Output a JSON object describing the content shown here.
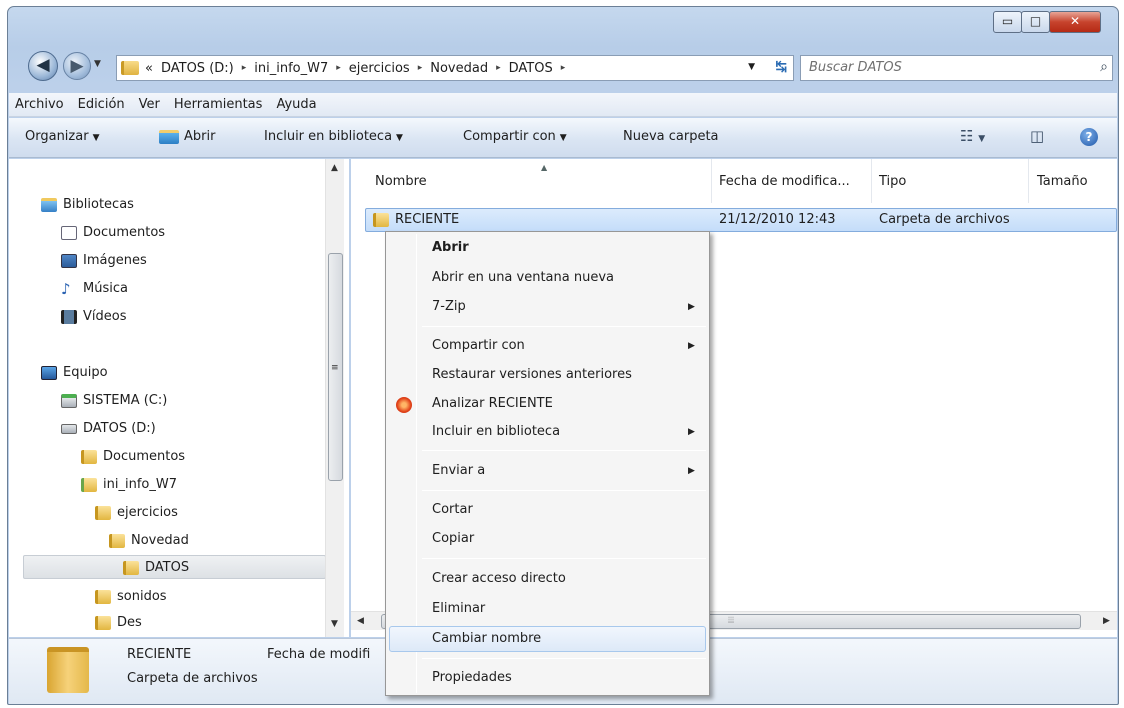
{
  "window": {
    "controls": {
      "minimize": "▭",
      "maximize": "□",
      "close": "✕"
    }
  },
  "nav": {
    "back_glyph": "◀",
    "forward_glyph": "▶",
    "address": {
      "prefix": "«",
      "crumbs": [
        "DATOS (D:)",
        "ini_info_W7",
        "ejercicios",
        "Novedad",
        "DATOS"
      ],
      "separator": "▸"
    },
    "search_placeholder": "Buscar DATOS"
  },
  "menubar": [
    "Archivo",
    "Edición",
    "Ver",
    "Herramientas",
    "Ayuda"
  ],
  "toolbar": {
    "organize": "Organizar",
    "open": "Abrir",
    "include_library": "Incluir en biblioteca",
    "share_with": "Compartir con",
    "new_folder": "Nueva carpeta",
    "help": "?"
  },
  "navpane": {
    "libraries": "Bibliotecas",
    "documents": "Documentos",
    "images": "Imágenes",
    "music": "Música",
    "videos": "Vídeos",
    "computer": "Equipo",
    "system_drive": "SISTEMA (C:)",
    "data_drive": "DATOS (D:)",
    "folder_documents": "Documentos",
    "folder_ini": "ini_info_W7",
    "folder_exercises": "ejercicios",
    "folder_novedad": "Novedad",
    "folder_datos": "DATOS",
    "folder_sonidos": "sonidos",
    "folder_des": "Des"
  },
  "columns": {
    "name": "Nombre",
    "date": "Fecha de modifica...",
    "type": "Tipo",
    "size": "Tamaño"
  },
  "files": [
    {
      "name": "RECIENTE",
      "date": "21/12/2010 12:43",
      "type": "Carpeta de archivos"
    }
  ],
  "details": {
    "name": "RECIENTE",
    "type": "Carpeta de archivos",
    "date_label": "Fecha de modifi"
  },
  "context_menu": {
    "open": "Abrir",
    "open_new_window": "Abrir en una ventana nueva",
    "sevenzip": "7-Zip",
    "share_with": "Compartir con",
    "restore_versions": "Restaurar versiones anteriores",
    "analyze": "Analizar RECIENTE",
    "include_library": "Incluir en biblioteca",
    "send_to": "Enviar a",
    "cut": "Cortar",
    "copy": "Copiar",
    "create_shortcut": "Crear acceso directo",
    "delete": "Eliminar",
    "rename": "Cambiar nombre",
    "properties": "Propiedades"
  }
}
